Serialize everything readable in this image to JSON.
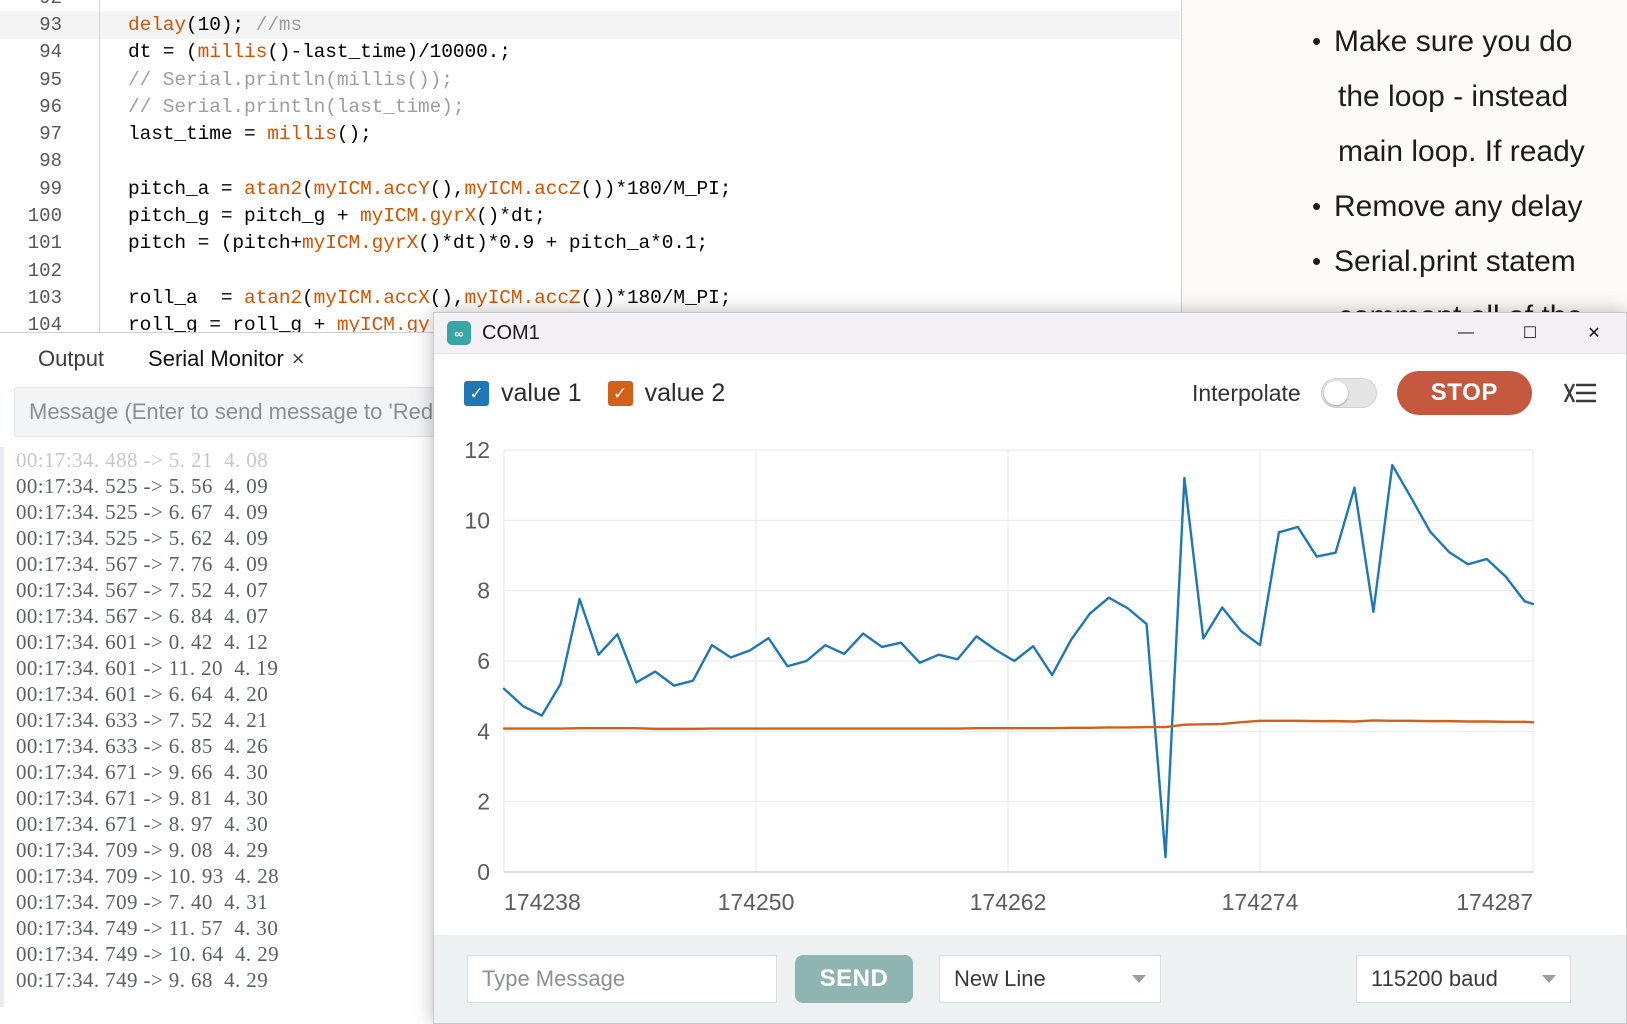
{
  "editor": {
    "lines": [
      {
        "num": "92",
        "partial": true,
        "tokens": []
      },
      {
        "num": "93",
        "active": true,
        "tokens": [
          {
            "t": "delay",
            "c": "kw"
          },
          {
            "t": "(10); ",
            "c": "plain"
          },
          {
            "t": "//ms",
            "c": "cm"
          }
        ]
      },
      {
        "num": "94",
        "tokens": [
          {
            "t": "dt = (",
            "c": "plain"
          },
          {
            "t": "millis",
            "c": "kw"
          },
          {
            "t": "()-last_time)/10000.;",
            "c": "plain"
          }
        ]
      },
      {
        "num": "95",
        "tokens": [
          {
            "t": "// Serial.println(millis());",
            "c": "cm"
          }
        ]
      },
      {
        "num": "96",
        "tokens": [
          {
            "t": "// Serial.println(last_time);",
            "c": "cm"
          }
        ]
      },
      {
        "num": "97",
        "tokens": [
          {
            "t": "last_time = ",
            "c": "plain"
          },
          {
            "t": "millis",
            "c": "kw"
          },
          {
            "t": "();",
            "c": "plain"
          }
        ]
      },
      {
        "num": "98",
        "tokens": []
      },
      {
        "num": "99",
        "tokens": [
          {
            "t": "pitch_a = ",
            "c": "plain"
          },
          {
            "t": "atan2",
            "c": "kw"
          },
          {
            "t": "(",
            "c": "plain"
          },
          {
            "t": "myICM.accY",
            "c": "kw"
          },
          {
            "t": "(),",
            "c": "plain"
          },
          {
            "t": "myICM.accZ",
            "c": "kw"
          },
          {
            "t": "())*180/M_PI;",
            "c": "plain"
          }
        ]
      },
      {
        "num": "100",
        "tokens": [
          {
            "t": "pitch_g = pitch_g + ",
            "c": "plain"
          },
          {
            "t": "myICM.gyrX",
            "c": "kw"
          },
          {
            "t": "()*dt;",
            "c": "plain"
          }
        ]
      },
      {
        "num": "101",
        "tokens": [
          {
            "t": "pitch = (pitch+",
            "c": "plain"
          },
          {
            "t": "myICM.gyrX",
            "c": "kw"
          },
          {
            "t": "()*dt)*0.9 + pitch_a*0.1;",
            "c": "plain"
          }
        ]
      },
      {
        "num": "102",
        "tokens": []
      },
      {
        "num": "103",
        "tokens": [
          {
            "t": "roll_a  = ",
            "c": "plain"
          },
          {
            "t": "atan2",
            "c": "kw"
          },
          {
            "t": "(",
            "c": "plain"
          },
          {
            "t": "myICM.accX",
            "c": "kw"
          },
          {
            "t": "(),",
            "c": "plain"
          },
          {
            "t": "myICM.accZ",
            "c": "kw"
          },
          {
            "t": "())*180/M_PI;",
            "c": "plain"
          }
        ]
      },
      {
        "num": "104",
        "tokens": [
          {
            "t": "roll_g = roll_g + ",
            "c": "plain"
          },
          {
            "t": "myICM.gy",
            "c": "kw"
          }
        ]
      }
    ]
  },
  "notes": {
    "items": [
      {
        "bullet": true,
        "text": "Make sure you do"
      },
      {
        "bullet": false,
        "text": "the loop - instead"
      },
      {
        "bullet": false,
        "text": "main loop. If ready"
      },
      {
        "bullet": true,
        "text": "Remove any delay"
      },
      {
        "bullet": true,
        "text": "Serial.print statem"
      },
      {
        "bullet": false,
        "text": "comment all of the"
      }
    ]
  },
  "bottom_panel": {
    "tabs": [
      {
        "label": "Output",
        "selected": false
      },
      {
        "label": "Serial Monitor",
        "selected": true
      }
    ],
    "close_label": "×",
    "message_placeholder": "Message (Enter to send message to 'RedBoard A",
    "monitor_lines": [
      "00:17:34. 488 -> 5. 21  4. 08",
      "00:17:34. 525 -> 5. 56  4. 09",
      "00:17:34. 525 -> 6. 67  4. 09",
      "00:17:34. 525 -> 5. 62  4. 09",
      "00:17:34. 567 -> 7. 76  4. 09",
      "00:17:34. 567 -> 7. 52  4. 07",
      "00:17:34. 567 -> 6. 84  4. 07",
      "00:17:34. 601 -> 0. 42  4. 12",
      "00:17:34. 601 -> 11. 20  4. 19",
      "00:17:34. 601 -> 6. 64  4. 20",
      "00:17:34. 633 -> 7. 52  4. 21",
      "00:17:34. 633 -> 6. 85  4. 26",
      "00:17:34. 671 -> 9. 66  4. 30",
      "00:17:34. 671 -> 9. 81  4. 30",
      "00:17:34. 671 -> 8. 97  4. 30",
      "00:17:34. 709 -> 9. 08  4. 29",
      "00:17:34. 709 -> 10. 93  4. 28",
      "00:17:34. 709 -> 7. 40  4. 31",
      "00:17:34. 749 -> 11. 57  4. 30",
      "00:17:34. 749 -> 10. 64  4. 29",
      "00:17:34. 749 -> 9. 68  4. 29"
    ]
  },
  "plotter": {
    "title": "COM1",
    "app_icon": "arduino-infinity-icon",
    "window_buttons": {
      "minimize": "—",
      "maximize": "☐",
      "close": "✕"
    },
    "legend": [
      {
        "label": "value 1",
        "color": "#1f77b4",
        "checked": true
      },
      {
        "label": "value 2",
        "color": "#d2601a",
        "checked": true
      }
    ],
    "interpolate_label": "Interpolate",
    "interpolate_on": false,
    "stop_label": "STOP",
    "clear_icon": "clear-output-icon",
    "footer": {
      "message_placeholder": "Type Message",
      "send_label": "SEND",
      "line_ending": "New Line",
      "baud": "115200 baud"
    }
  },
  "chart_data": {
    "type": "line",
    "title": "",
    "xlabel": "",
    "ylabel": "",
    "grid": true,
    "legend_position": "top-left",
    "ylim": [
      0,
      12
    ],
    "yticks": [
      0,
      2,
      4,
      6,
      8,
      10,
      12
    ],
    "xlim": [
      174238,
      174287
    ],
    "xticks": [
      174238,
      174250,
      174262,
      174274,
      174287
    ],
    "xtick_labels": [
      "174238",
      "174250",
      "174262",
      "174274",
      "174287"
    ],
    "x": [
      174238.0,
      174238.9,
      174239.8,
      174240.7,
      174241.6,
      174242.5,
      174243.4,
      174244.3,
      174245.2,
      174246.1,
      174247.0,
      174247.9,
      174248.8,
      174249.7,
      174250.6,
      174251.5,
      174252.4,
      174253.3,
      174254.2,
      174255.1,
      174256.0,
      174256.9,
      174257.8,
      174258.7,
      174259.6,
      174260.5,
      174261.4,
      174262.3,
      174263.2,
      174264.1,
      174265.0,
      174265.9,
      174266.8,
      174267.7,
      174268.6,
      174269.5,
      174270.4,
      174271.3,
      174272.2,
      174273.1,
      174274.0,
      174274.9,
      174275.8,
      174276.7,
      174277.6,
      174278.5,
      174279.4,
      174280.3,
      174281.2,
      174282.1,
      174283.0,
      174283.9,
      174284.8,
      174285.7,
      174286.6,
      174287.0
    ],
    "series": [
      {
        "name": "value 1",
        "color": "#1f77b4",
        "values": [
          5.21,
          4.72,
          4.45,
          5.35,
          7.76,
          6.18,
          6.76,
          5.39,
          5.7,
          5.3,
          5.44,
          6.45,
          6.1,
          6.3,
          6.65,
          5.85,
          6.0,
          6.45,
          6.2,
          6.78,
          6.4,
          6.52,
          5.95,
          6.18,
          6.05,
          6.7,
          6.32,
          6.0,
          6.42,
          5.6,
          6.6,
          7.35,
          7.8,
          7.5,
          7.05,
          0.42,
          11.2,
          6.64,
          7.52,
          6.85,
          6.45,
          9.66,
          9.81,
          8.97,
          9.08,
          10.93,
          7.4,
          11.57,
          10.64,
          9.68,
          9.1,
          8.75,
          8.9,
          8.4,
          7.7,
          7.62
        ]
      },
      {
        "name": "value 2",
        "color": "#d2601a",
        "values": [
          4.08,
          4.08,
          4.08,
          4.08,
          4.09,
          4.09,
          4.09,
          4.09,
          4.07,
          4.07,
          4.07,
          4.08,
          4.08,
          4.08,
          4.08,
          4.08,
          4.08,
          4.08,
          4.08,
          4.08,
          4.08,
          4.08,
          4.08,
          4.08,
          4.08,
          4.09,
          4.09,
          4.09,
          4.09,
          4.09,
          4.1,
          4.1,
          4.11,
          4.11,
          4.12,
          4.12,
          4.19,
          4.2,
          4.21,
          4.26,
          4.3,
          4.3,
          4.3,
          4.29,
          4.29,
          4.28,
          4.31,
          4.3,
          4.3,
          4.29,
          4.29,
          4.28,
          4.28,
          4.27,
          4.27,
          4.26
        ]
      }
    ]
  }
}
